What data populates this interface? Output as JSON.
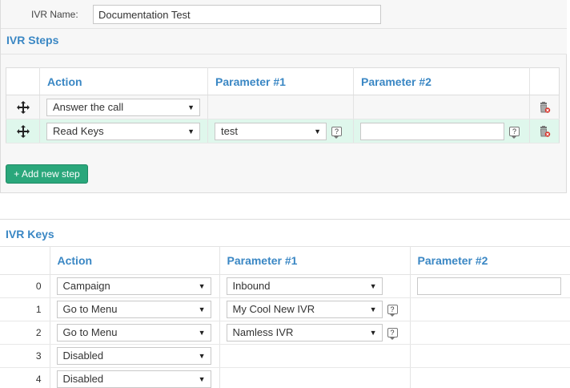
{
  "ivr_name": {
    "label": "IVR Name:",
    "value": "Documentation Test"
  },
  "steps": {
    "title": "IVR Steps",
    "headers": {
      "action": "Action",
      "param1": "Parameter #1",
      "param2": "Parameter #2"
    },
    "rows": [
      {
        "action": "Answer the call",
        "param1": "",
        "param2": ""
      },
      {
        "action": "Read Keys",
        "param1": "test",
        "param2": ""
      }
    ],
    "add_button": "+ Add new step"
  },
  "keys": {
    "title": "IVR Keys",
    "headers": {
      "action": "Action",
      "param1": "Parameter #1",
      "param2": "Parameter #2"
    },
    "rows": [
      {
        "key": "0",
        "action": "Campaign",
        "param1": "Inbound"
      },
      {
        "key": "1",
        "action": "Go to Menu",
        "param1": "My Cool New IVR"
      },
      {
        "key": "2",
        "action": "Go to Menu",
        "param1": "Namless IVR"
      },
      {
        "key": "3",
        "action": "Disabled"
      },
      {
        "key": "4",
        "action": "Disabled"
      }
    ]
  },
  "icons": {
    "drag": "move-arrows-icon",
    "delete": "trash-delete-icon",
    "help": "help-question-icon",
    "dropdown": "dropdown-arrow-icon"
  },
  "colors": {
    "accent": "#3a87c4",
    "button": "#2aa77b",
    "highlight_row": "#dff7ec"
  }
}
